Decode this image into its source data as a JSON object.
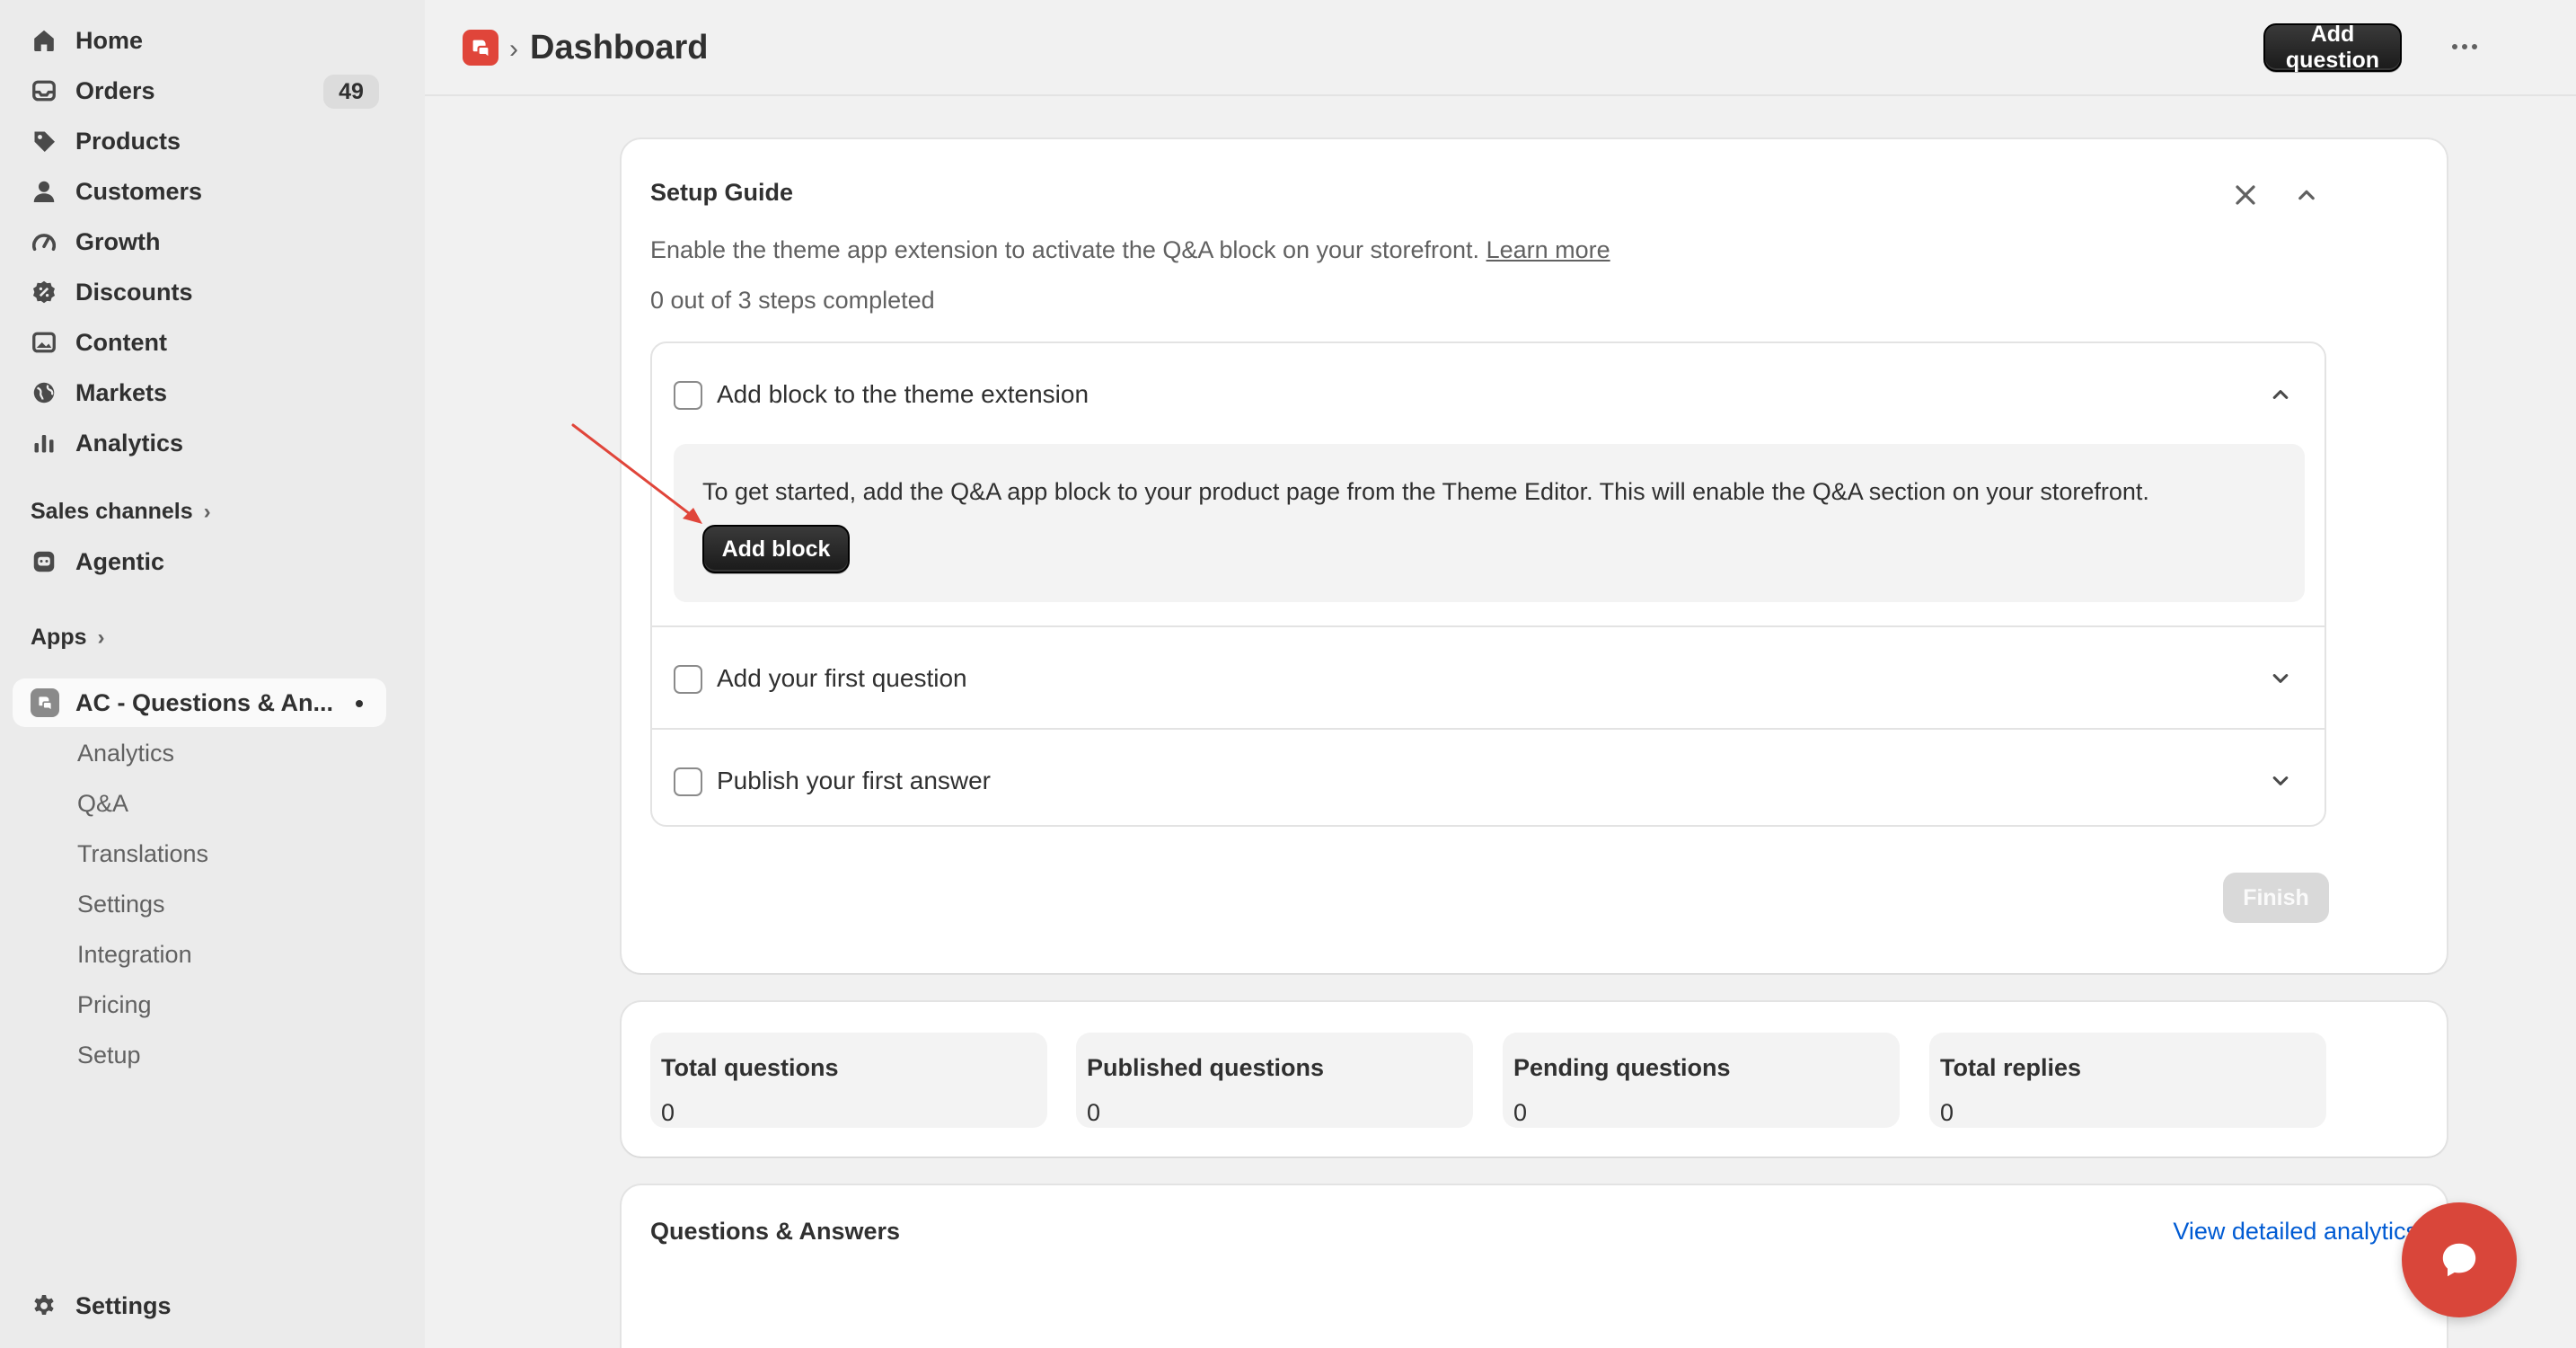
{
  "sidebar": {
    "items": [
      {
        "label": "Home",
        "icon": "home-icon"
      },
      {
        "label": "Orders",
        "icon": "inbox-icon",
        "badge": "49"
      },
      {
        "label": "Products",
        "icon": "tag-icon"
      },
      {
        "label": "Customers",
        "icon": "person-icon"
      },
      {
        "label": "Growth",
        "icon": "gauge-icon"
      },
      {
        "label": "Discounts",
        "icon": "discount-icon"
      },
      {
        "label": "Content",
        "icon": "image-icon"
      },
      {
        "label": "Markets",
        "icon": "globe-icon"
      },
      {
        "label": "Analytics",
        "icon": "bar-chart-icon"
      }
    ],
    "sales_channels": {
      "label": "Sales channels",
      "chevron": "›"
    },
    "agentic": {
      "label": "Agentic",
      "icon": "bot-icon"
    },
    "apps": {
      "label": "Apps",
      "chevron": "›"
    },
    "active_app": {
      "label": "AC - Questions & An...",
      "icon": "app-logo-icon"
    },
    "app_subitems": [
      "Analytics",
      "Q&A",
      "Translations",
      "Settings",
      "Integration",
      "Pricing",
      "Setup"
    ],
    "settings": {
      "label": "Settings",
      "icon": "gear-icon"
    }
  },
  "topbar": {
    "separator": "›",
    "title": "Dashboard",
    "add_question_label": "Add question"
  },
  "setup_guide": {
    "title": "Setup Guide",
    "description": "Enable the theme app extension to activate the Q&A block on your storefront.",
    "learn_more": "Learn more",
    "progress": "0 out of 3 steps completed",
    "steps": [
      {
        "label": "Add block to the theme extension",
        "expanded": true,
        "body": "To get started, add the Q&A app block to your product page from the Theme Editor. This will enable the Q&A section on your storefront.",
        "button": "Add block"
      },
      {
        "label": "Add your first question",
        "expanded": false
      },
      {
        "label": "Publish your first answer",
        "expanded": false
      }
    ],
    "finish_label": "Finish"
  },
  "stats": [
    {
      "label": "Total questions",
      "value": "0"
    },
    {
      "label": "Published questions",
      "value": "0"
    },
    {
      "label": "Pending questions",
      "value": "0"
    },
    {
      "label": "Total replies",
      "value": "0"
    }
  ],
  "qa": {
    "title": "Questions & Answers",
    "link": "View detailed analytics"
  },
  "colors": {
    "brand": "#e0453a",
    "link": "#005bd3",
    "chat": "#d9463a",
    "arrow": "#e0453a"
  }
}
